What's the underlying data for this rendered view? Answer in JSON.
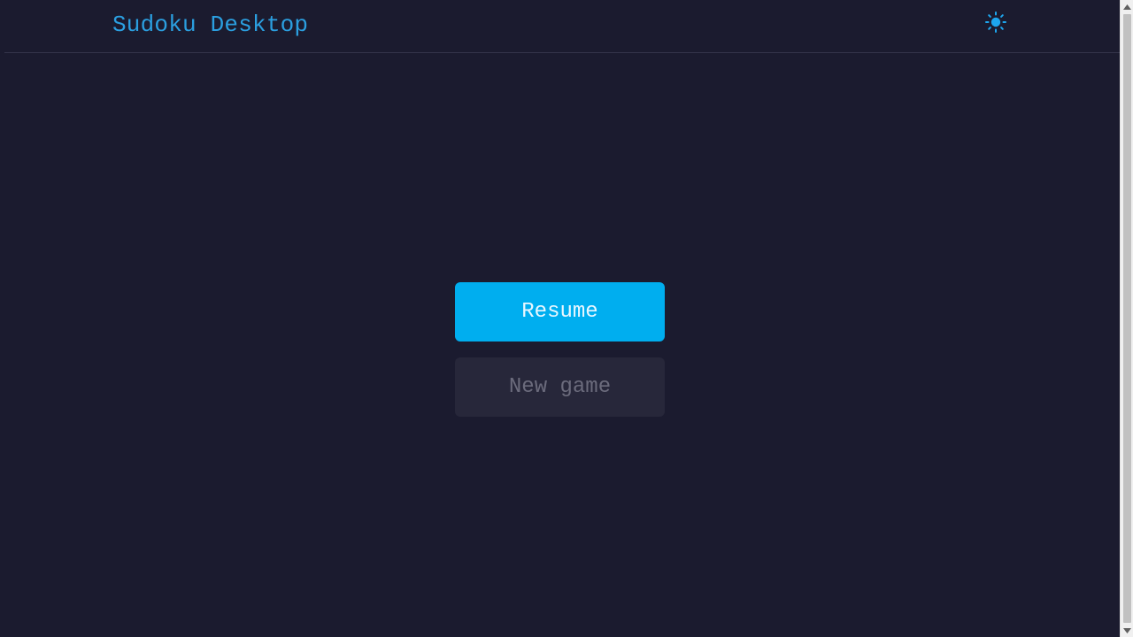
{
  "header": {
    "title": "Sudoku Desktop",
    "theme_toggle_icon": "sun-icon"
  },
  "menu": {
    "resume_label": "Resume",
    "new_game_label": "New game"
  },
  "colors": {
    "background": "#1b1b2f",
    "accent": "#00aeef",
    "title": "#2b9fe0",
    "disabled_button": "#27273a",
    "disabled_text": "#6b6b7c"
  }
}
